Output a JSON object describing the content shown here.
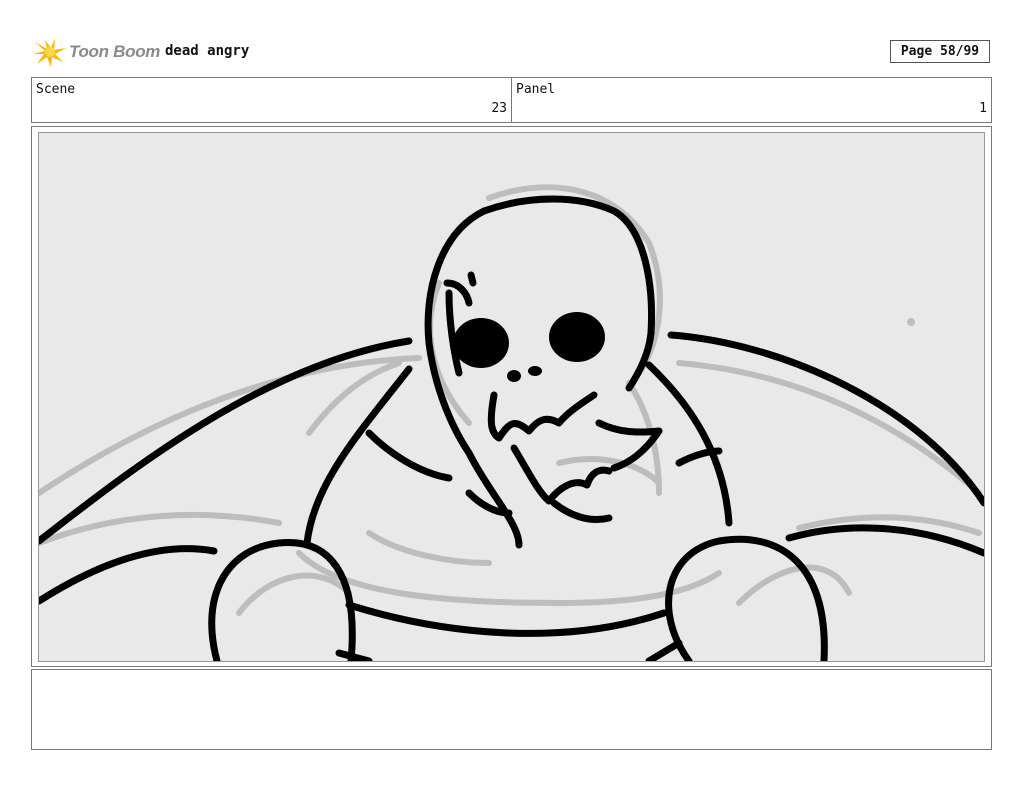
{
  "header": {
    "logo_text": "Toon Boom",
    "project_title": "dead angry",
    "page_indicator": "Page 58/99"
  },
  "scene": {
    "label": "Scene",
    "value": "23"
  },
  "panel": {
    "label": "Panel",
    "value": "1"
  },
  "drawing": {
    "description_icon": "storyboard-sketch",
    "background_color": "#e9e9e9",
    "line_color": "#000000",
    "rough_line_color": "#bdbdbd"
  },
  "notes": {
    "text": ""
  },
  "colors": {
    "logo_yellow": "#f5b800",
    "logo_gray": "#8a8a8a"
  }
}
